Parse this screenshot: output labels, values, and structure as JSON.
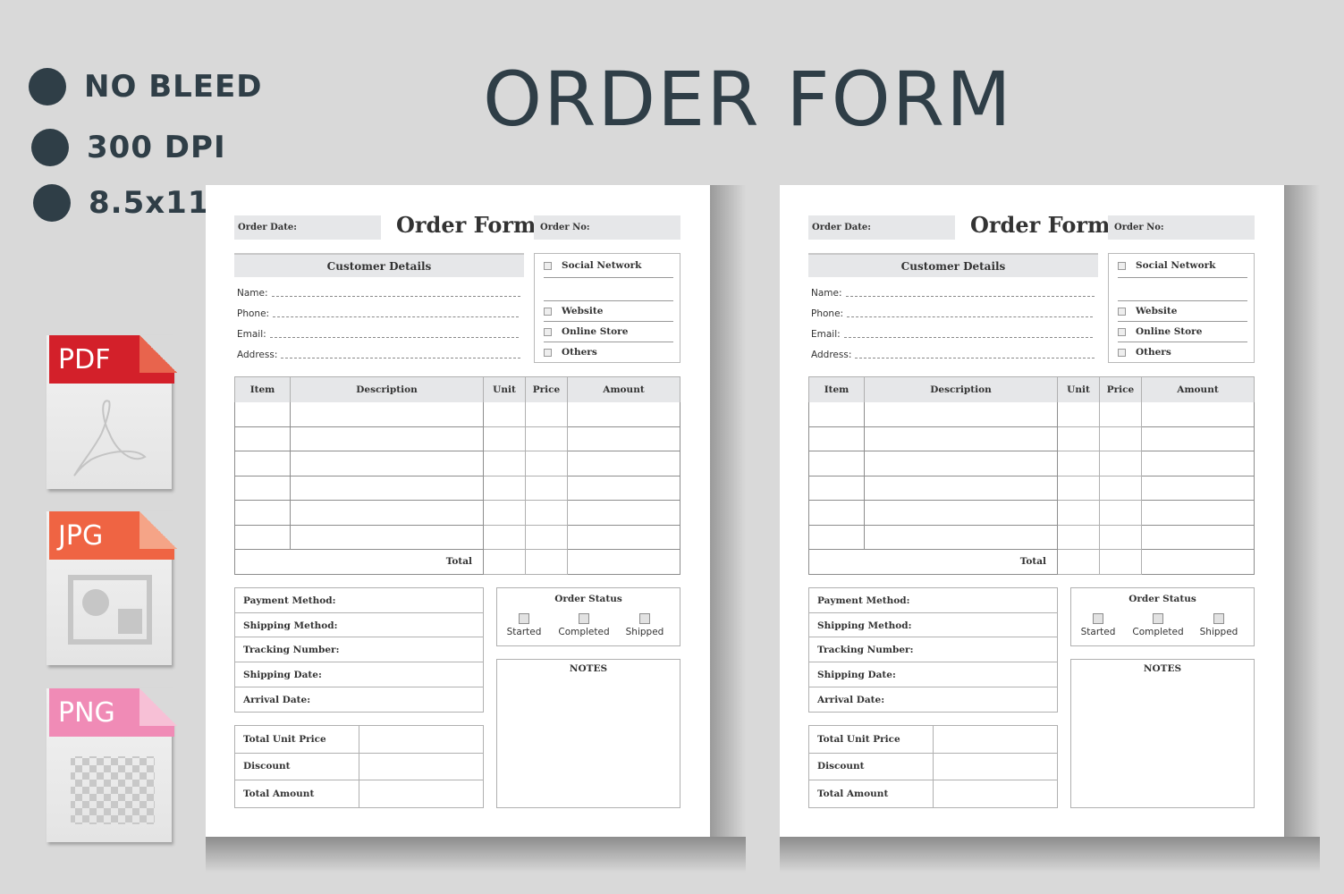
{
  "banner": {
    "features": [
      "NO  BLEED",
      "300 DPI",
      "8.5x11"
    ],
    "title": "ORDER FORM",
    "colors": {
      "text": "#2f3e47",
      "background": "#d9d9d9"
    }
  },
  "file_formats": [
    {
      "label": "PDF",
      "color": "#d3202a",
      "icon": "acrobat-icon"
    },
    {
      "label": "JPG",
      "color": "#ef6443",
      "icon": "image-icon"
    },
    {
      "label": "PNG",
      "color": "#f08bb6",
      "icon": "transparency-grid-icon"
    }
  ],
  "form": {
    "order_date_label": "Order Date:",
    "title": "Order Form",
    "order_no_label": "Order No:",
    "customer_details": {
      "heading": "Customer Details",
      "fields": [
        "Name:",
        "Phone:",
        "Email:",
        "Address:"
      ]
    },
    "channels": [
      "Social Network",
      "Website",
      "Online Store",
      "Others"
    ],
    "items_table": {
      "columns": [
        "Item",
        "Description",
        "Unit",
        "Price",
        "Amount"
      ],
      "empty_rows": 6,
      "total_label": "Total"
    },
    "shipping_fields": [
      "Payment Method:",
      "Shipping Method:",
      "Tracking Number:",
      "Shipping Date:",
      "Arrival Date:"
    ],
    "summary": [
      "Total Unit Price",
      "Discount",
      "Total Amount"
    ],
    "order_status": {
      "title": "Order Status",
      "options": [
        "Started",
        "Completed",
        "Shipped"
      ]
    },
    "notes_title": "NOTES"
  }
}
